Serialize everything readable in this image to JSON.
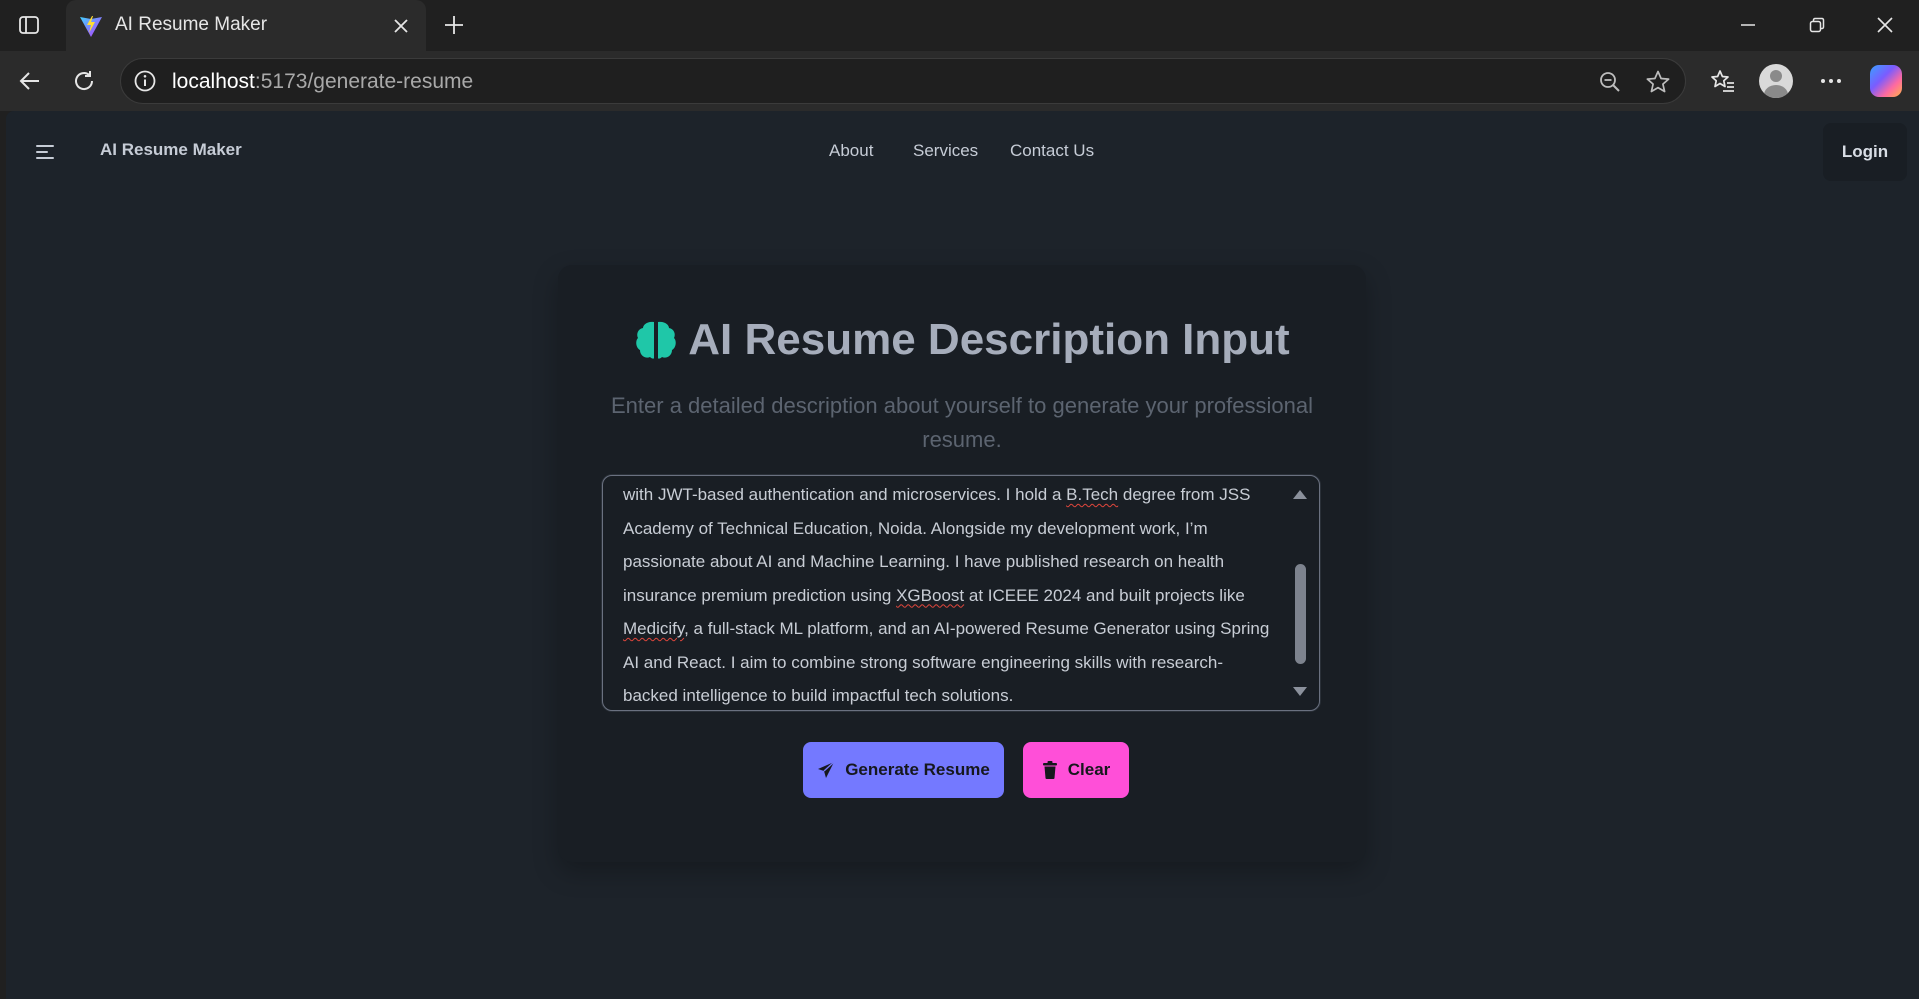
{
  "browser": {
    "tab_title": "AI Resume Maker",
    "url_host": "localhost",
    "url_path": ":5173/generate-resume"
  },
  "nav": {
    "brand": "AI Resume Maker",
    "links": [
      "About",
      "Services",
      "Contact Us"
    ],
    "login_label": "Login"
  },
  "card": {
    "title": "AI Resume Description Input",
    "subtitle": "Enter a detailed description about yourself to generate your professional resume.",
    "textarea_segments": [
      "with JWT-based authentication and microservices. I hold a ",
      "B.Tech",
      " degree from JSS Academy of Technical Education, Noida. Alongside my development work, I’m passionate about AI and Machine Learning. I have published research on health insurance premium prediction using ",
      "XGBoost",
      " at ICEEE 2024 and built projects like ",
      "Medicify",
      ", a full-stack ML platform, and an AI-powered Resume Generator using Spring AI and React. I aim to combine strong software engineering skills with research-backed intelligence to build impactful tech solutions."
    ],
    "generate_label": "Generate Resume",
    "clear_label": "Clear"
  },
  "colors": {
    "accent_brain": "#1fc7a8",
    "generate_button": "#7479ff",
    "clear_button": "#ff4fd8",
    "page_bg": "#1d232a",
    "card_bg": "#191e24"
  },
  "icons": [
    "sidebar-icon",
    "vite-favicon",
    "close-icon",
    "plus-icon",
    "minimize-icon",
    "restore-icon",
    "window-close-icon",
    "back-icon",
    "refresh-icon",
    "info-icon",
    "zoom-out-icon",
    "star-icon",
    "favorites-icon",
    "profile-avatar",
    "more-icon",
    "copilot-icon",
    "hamburger-icon",
    "brain-icon",
    "paper-plane-icon",
    "trash-icon"
  ]
}
